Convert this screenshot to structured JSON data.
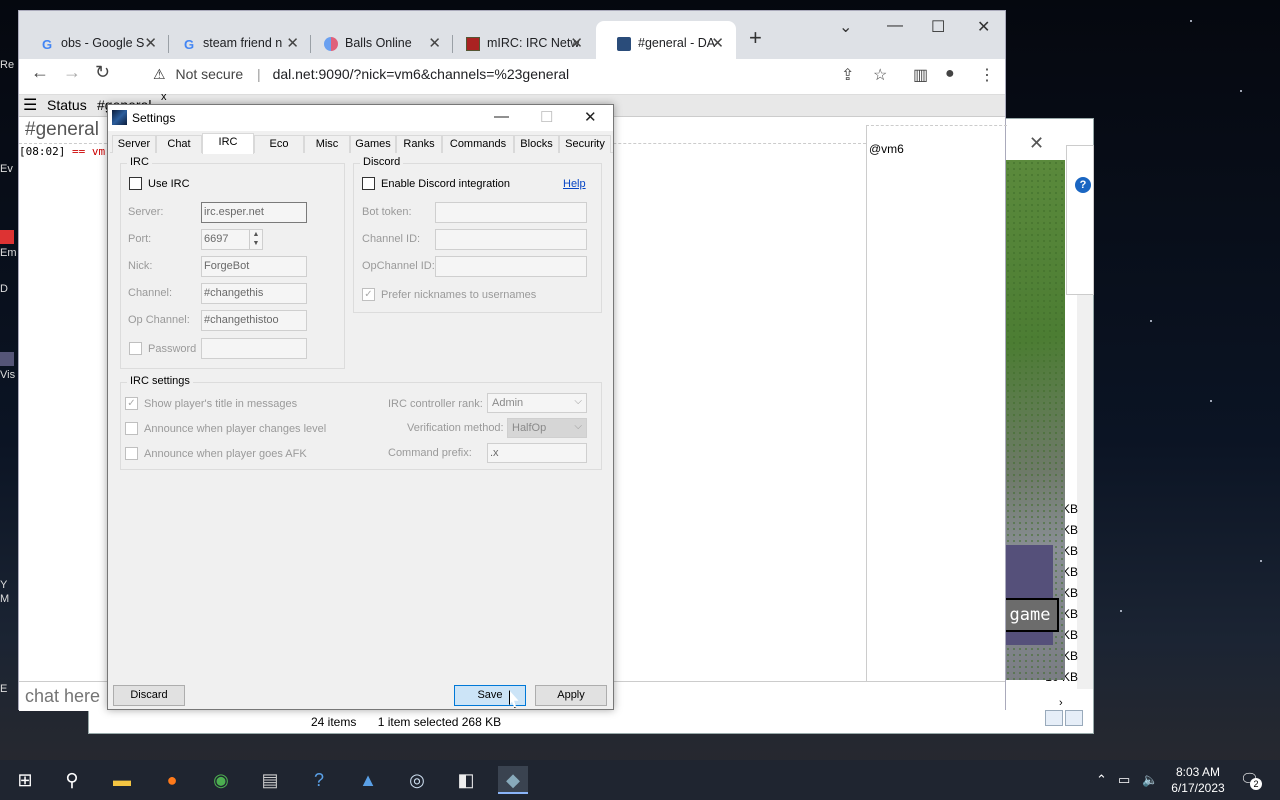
{
  "browser": {
    "tabs": [
      {
        "title": "obs - Google S",
        "icon": "google-icon"
      },
      {
        "title": "steam friend n",
        "icon": "google-icon"
      },
      {
        "title": "Balls Online",
        "icon": "balls-icon"
      },
      {
        "title": "mIRC: IRC Netw",
        "icon": "mirc-icon"
      },
      {
        "title": "#general - DA",
        "icon": "irc-icon"
      }
    ],
    "address": {
      "warning": "Not secure",
      "url": "dal.net:9090/?nick=vm6&channels=%23general"
    }
  },
  "irc": {
    "status_tab": "Status",
    "channel_tab": "#general",
    "channel_title": "#general",
    "message_time": "[08:02]",
    "message_text": "== vm",
    "nick": "@vm6",
    "chat_placeholder": "chat here"
  },
  "explorer": {
    "items_count": "24 items",
    "selected": "1 item selected  268 KB",
    "sizes": [
      "KB",
      "KB",
      "KB",
      "KB",
      "KB",
      "KB",
      "KB",
      "1 KB",
      "10 KB"
    ]
  },
  "minecraft": {
    "button_label": "game"
  },
  "desktop": {
    "labels": [
      "Re",
      "Ev",
      "Em",
      "D",
      "Vis",
      "Y",
      "M",
      "E"
    ]
  },
  "settings": {
    "title": "Settings",
    "tabs": [
      "Server",
      "Chat",
      "IRC",
      "Eco",
      "Misc",
      "Games",
      "Ranks",
      "Commands",
      "Blocks",
      "Security"
    ],
    "active_tab": "IRC",
    "irc_group": {
      "title": "IRC",
      "use_irc_label": "Use IRC",
      "server_label": "Server:",
      "server_value": "irc.esper.net",
      "port_label": "Port:",
      "port_value": "6697",
      "nick_label": "Nick:",
      "nick_value": "ForgeBot",
      "channel_label": "Channel:",
      "channel_value": "#changethis",
      "opchannel_label": "Op Channel:",
      "opchannel_value": "#changethistoo",
      "password_label": "Password"
    },
    "discord_group": {
      "title": "Discord",
      "enable_label": "Enable Discord integration",
      "help_link": "Help",
      "bot_token_label": "Bot token:",
      "channel_id_label": "Channel ID:",
      "opchannel_id_label": "OpChannel ID:",
      "prefer_nicknames_label": "Prefer nicknames to usernames"
    },
    "irc_settings_group": {
      "title": "IRC settings",
      "show_title_label": "Show player's title in messages",
      "announce_level_label": "Announce when player changes level",
      "announce_afk_label": "Announce when player goes AFK",
      "controller_rank_label": "IRC controller rank:",
      "controller_rank_value": "Admin",
      "verification_label": "Verification method:",
      "verification_value": "HalfOp",
      "command_prefix_label": "Command prefix:",
      "command_prefix_value": ".x"
    },
    "buttons": {
      "discard": "Discard",
      "save": "Save",
      "apply": "Apply"
    }
  },
  "taskbar": {
    "time": "8:03 AM",
    "date": "6/17/2023",
    "notifications": "2"
  }
}
